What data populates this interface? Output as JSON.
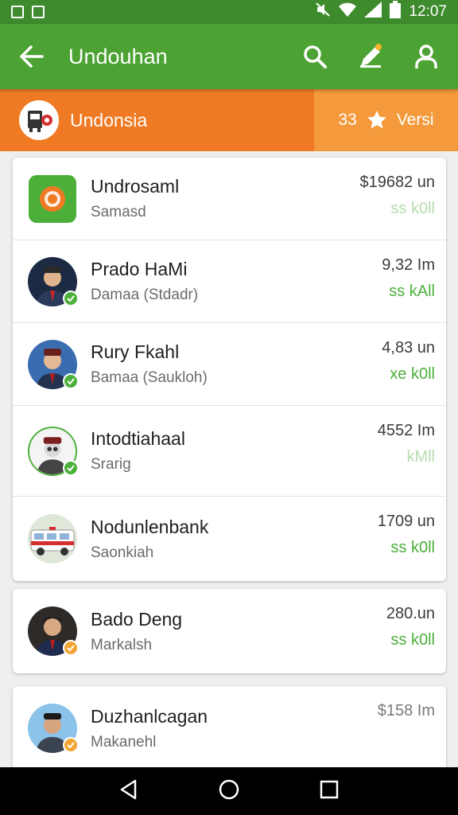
{
  "status": {
    "time": "12:07"
  },
  "appbar": {
    "title": "Undouhan"
  },
  "banner": {
    "name": "Undonsia",
    "count": "33",
    "label": "Versi"
  },
  "colors": {
    "primary": "#4ca233",
    "status": "#3d8b2c",
    "banner_left": "#ef7a23",
    "banner_right": "#f49a3c",
    "success": "#4caf3a",
    "badge_green": "#4caf3a",
    "badge_orange": "#f2a533"
  },
  "card1": {
    "rows": [
      {
        "name": "Undrosaml",
        "sub": "Samasd",
        "amount": "$19682 un",
        "status": "ss k0ll",
        "icon": "app-logo-icon"
      },
      {
        "name": "Prado HaMi",
        "sub": "Damaa (Stdadr)",
        "amount": "9,32 Im",
        "status": "ss kAll",
        "icon": "verified-icon"
      },
      {
        "name": "Rury Fkahl",
        "sub": "Bamaa (Saukloh)",
        "amount": "4,83 un",
        "status": "xe k0ll",
        "icon": "verified-icon"
      },
      {
        "name": "Intodtiahaal",
        "sub": "Srarig",
        "amount": "4552 Im",
        "status": "kMll",
        "icon": "verified-icon"
      },
      {
        "name": "Nodunlenbank",
        "sub": "Saonkiah",
        "amount": "1709 un",
        "status": "ss k0ll",
        "icon": "verified-icon"
      }
    ]
  },
  "card2": {
    "rows": [
      {
        "name": "Bado Deng",
        "sub": "Markalsh",
        "amount": "280.un",
        "status": "ss k0ll",
        "icon": "pending-icon"
      }
    ]
  },
  "card3": {
    "rows": [
      {
        "name": "Duzhanlcagan",
        "sub": "Makanehl",
        "amount": "$158 Im",
        "status": "",
        "icon": "pending-icon"
      }
    ]
  }
}
